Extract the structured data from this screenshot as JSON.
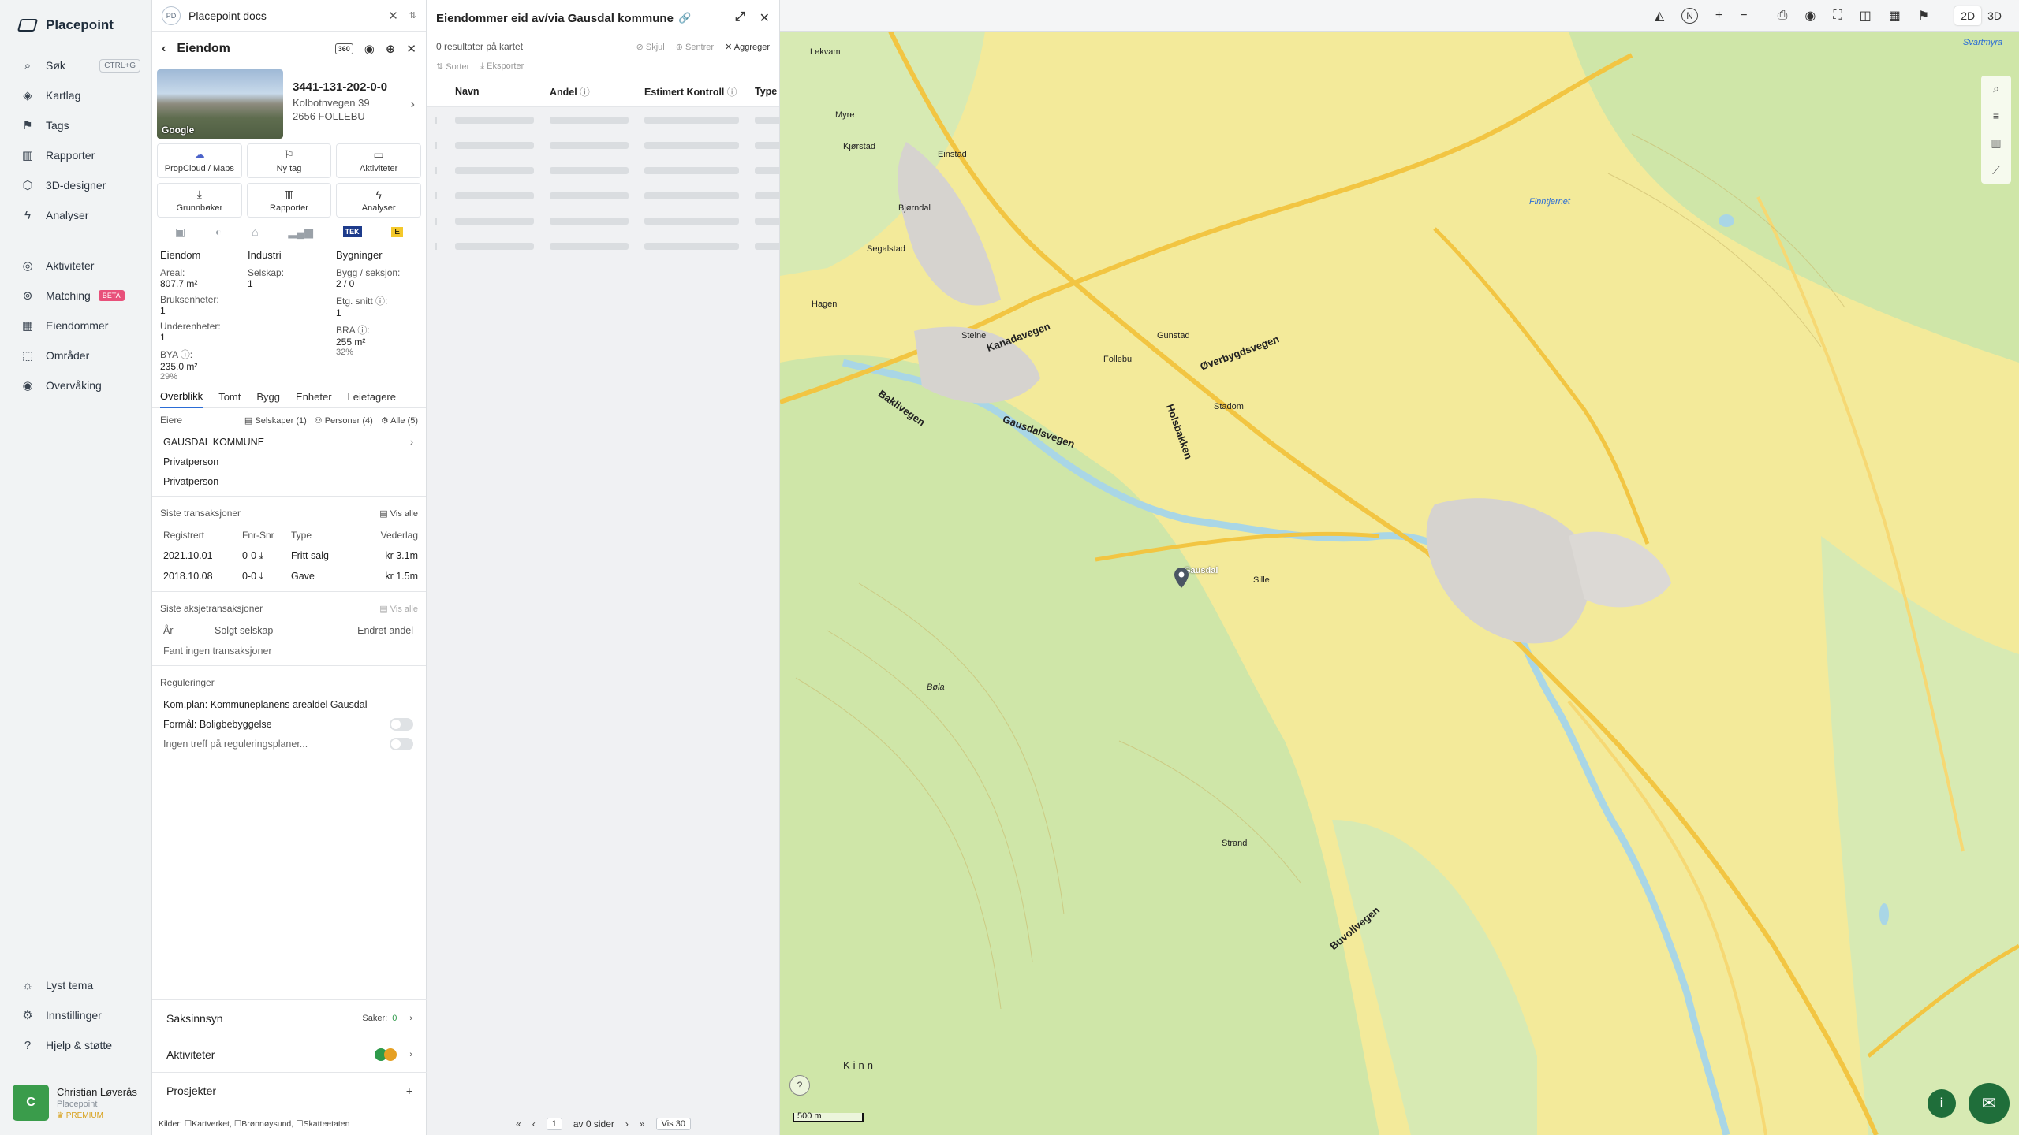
{
  "brand": {
    "name": "Placepoint"
  },
  "nav": {
    "search": {
      "label": "Søk",
      "kbd": "CTRL+G"
    },
    "items_top": [
      {
        "label": "Kartlag",
        "icon": "layers-icon"
      },
      {
        "label": "Tags",
        "icon": "bookmark-icon"
      },
      {
        "label": "Rapporter",
        "icon": "chart-icon"
      },
      {
        "label": "3D-designer",
        "icon": "cube-icon"
      },
      {
        "label": "Analyser",
        "icon": "bolt-icon"
      }
    ],
    "items_mid": [
      {
        "label": "Aktiviteter",
        "icon": "chat-icon"
      },
      {
        "label": "Matching",
        "icon": "target-icon",
        "badge": "BETA"
      },
      {
        "label": "Eiendommer",
        "icon": "grid-icon"
      },
      {
        "label": "Områder",
        "icon": "area-icon"
      },
      {
        "label": "Overvåking",
        "icon": "globe-icon"
      }
    ],
    "items_bottom": [
      {
        "label": "Lyst tema",
        "icon": "sun-icon"
      },
      {
        "label": "Innstillinger",
        "icon": "gear-icon"
      },
      {
        "label": "Hjelp & støtte",
        "icon": "help-icon"
      }
    ]
  },
  "user": {
    "initial": "C",
    "name": "Christian Løverås",
    "org": "Placepoint",
    "plan": "PREMIUM"
  },
  "docbar": {
    "icon_text": "PD",
    "title": "Placepoint docs"
  },
  "panel": {
    "title": "Eiendom",
    "badge360": "360",
    "property": {
      "id": "3441-131-202-0-0",
      "street": "Kolbotnvegen 39",
      "city": "2656 FOLLEBU",
      "img_credit": "Google"
    },
    "tiles": [
      {
        "label": "PropCloud / Maps",
        "icon": "cloud-icon"
      },
      {
        "label": "Ny tag",
        "icon": "bookmark-icon"
      },
      {
        "label": "Aktiviteter",
        "icon": "chat-icon"
      },
      {
        "label": "Grunnbøker",
        "icon": "download-icon"
      },
      {
        "label": "Rapporter",
        "icon": "chart-icon"
      },
      {
        "label": "Analyser",
        "icon": "bolt-icon"
      }
    ],
    "badge_tek": "TEK",
    "badge_energy": "E",
    "stats": {
      "col1_head": "Eiendom",
      "col2_head": "Industri",
      "col3_head": "Bygninger",
      "areal_label": "Areal:",
      "areal_value": "807.7 m²",
      "bruks_label": "Bruksenheter:",
      "bruks_value": "1",
      "under_label": "Underenheter:",
      "under_value": "1",
      "bya_label": "BYA ⓘ:",
      "bya_value": "235.0 m²",
      "bya_pct": "29%",
      "selskap_label": "Selskap:",
      "selskap_value": "1",
      "bygg_label": "Bygg / seksjon:",
      "bygg_value": "2 / 0",
      "etg_label": "Etg. snitt ⓘ:",
      "etg_value": "1",
      "bra_label": "BRA ⓘ:",
      "bra_value": "255 m²",
      "bra_pct": "32%"
    },
    "tabs": [
      "Overblikk",
      "Tomt",
      "Bygg",
      "Enheter",
      "Leietagere"
    ],
    "owners": {
      "label": "Eiere",
      "filter_companies": "Selskaper (1)",
      "filter_persons": "Personer (4)",
      "filter_all": "Alle (5)",
      "list": [
        "GAUSDAL KOMMUNE",
        "Privatperson",
        "Privatperson"
      ]
    },
    "transactions": {
      "label": "Siste transaksjoner",
      "view_all": "Vis alle",
      "headers": [
        "Registrert",
        "Fnr-Snr",
        "Type",
        "Vederlag"
      ],
      "rows": [
        {
          "date": "2021.10.01",
          "fnr": "0-0",
          "type": "Fritt salg",
          "amount": "kr 3.1m"
        },
        {
          "date": "2018.10.08",
          "fnr": "0-0",
          "type": "Gave",
          "amount": "kr 1.5m"
        }
      ]
    },
    "share_tx": {
      "label": "Siste aksjetransaksjoner",
      "view_all": "Vis alle",
      "headers": [
        "År",
        "Solgt selskap",
        "Endret andel"
      ],
      "empty": "Fant ingen transaksjoner"
    },
    "regulations": {
      "label": "Reguleringer",
      "plan": "Kom.plan: Kommuneplanens arealdel Gausdal",
      "formal": "Formål: Boligbebyggelse",
      "none": "Ingen treff på reguleringsplaner..."
    },
    "accordions": {
      "saksinnsyn": "Saksinnsyn",
      "saker_label": "Saker:",
      "saker_count": "0",
      "aktiviteter": "Aktiviteter",
      "prosjekter": "Prosjekter"
    },
    "sources": {
      "label": "Kilder:",
      "items": [
        "Kartverket",
        "Brønnøysund",
        "Skatteetaten"
      ]
    }
  },
  "mid": {
    "title": "Eiendommer eid av/via Gausdal kommune",
    "results": "0 resultater på kartet",
    "hide": "Skjul",
    "center": "Sentrer",
    "aggregate": "Aggreger",
    "sort": "Sorter",
    "export": "Eksporter",
    "columns": [
      "Navn",
      "Andel",
      "Estimert Kontroll",
      "Type"
    ],
    "pager": {
      "page": "1",
      "of_label": "av 0 sider",
      "per_page": "Vis 30"
    }
  },
  "map": {
    "scale": "500 m",
    "places": [
      {
        "t": "Lekvam"
      },
      {
        "t": "Myre"
      },
      {
        "t": "Kjørstad"
      },
      {
        "t": "Einstad"
      },
      {
        "t": "Bjørndal"
      },
      {
        "t": "Segalstad"
      },
      {
        "t": "Hagen"
      },
      {
        "t": "Steine"
      },
      {
        "t": "Kanadavegen"
      },
      {
        "t": "Øverbygdsvegen"
      },
      {
        "t": "Gausdalsvegen"
      },
      {
        "t": "Baklivegen"
      },
      {
        "t": "Follebu"
      },
      {
        "t": "Gunstad"
      },
      {
        "t": "Stadom"
      },
      {
        "t": "Sille"
      },
      {
        "t": "Holsbakken"
      },
      {
        "t": "Bøla"
      },
      {
        "t": "Kinn"
      },
      {
        "t": "Strand"
      },
      {
        "t": "Buvollvegen"
      },
      {
        "t": "Finntjernet"
      },
      {
        "t": "Svartmyra"
      },
      {
        "t": "Gausdal"
      }
    ]
  },
  "colors": {
    "accent": "#2a6cd6",
    "green": "#1f6e3a",
    "map_yellow": "#f3ea9a",
    "map_green": "#cfe6a8"
  }
}
